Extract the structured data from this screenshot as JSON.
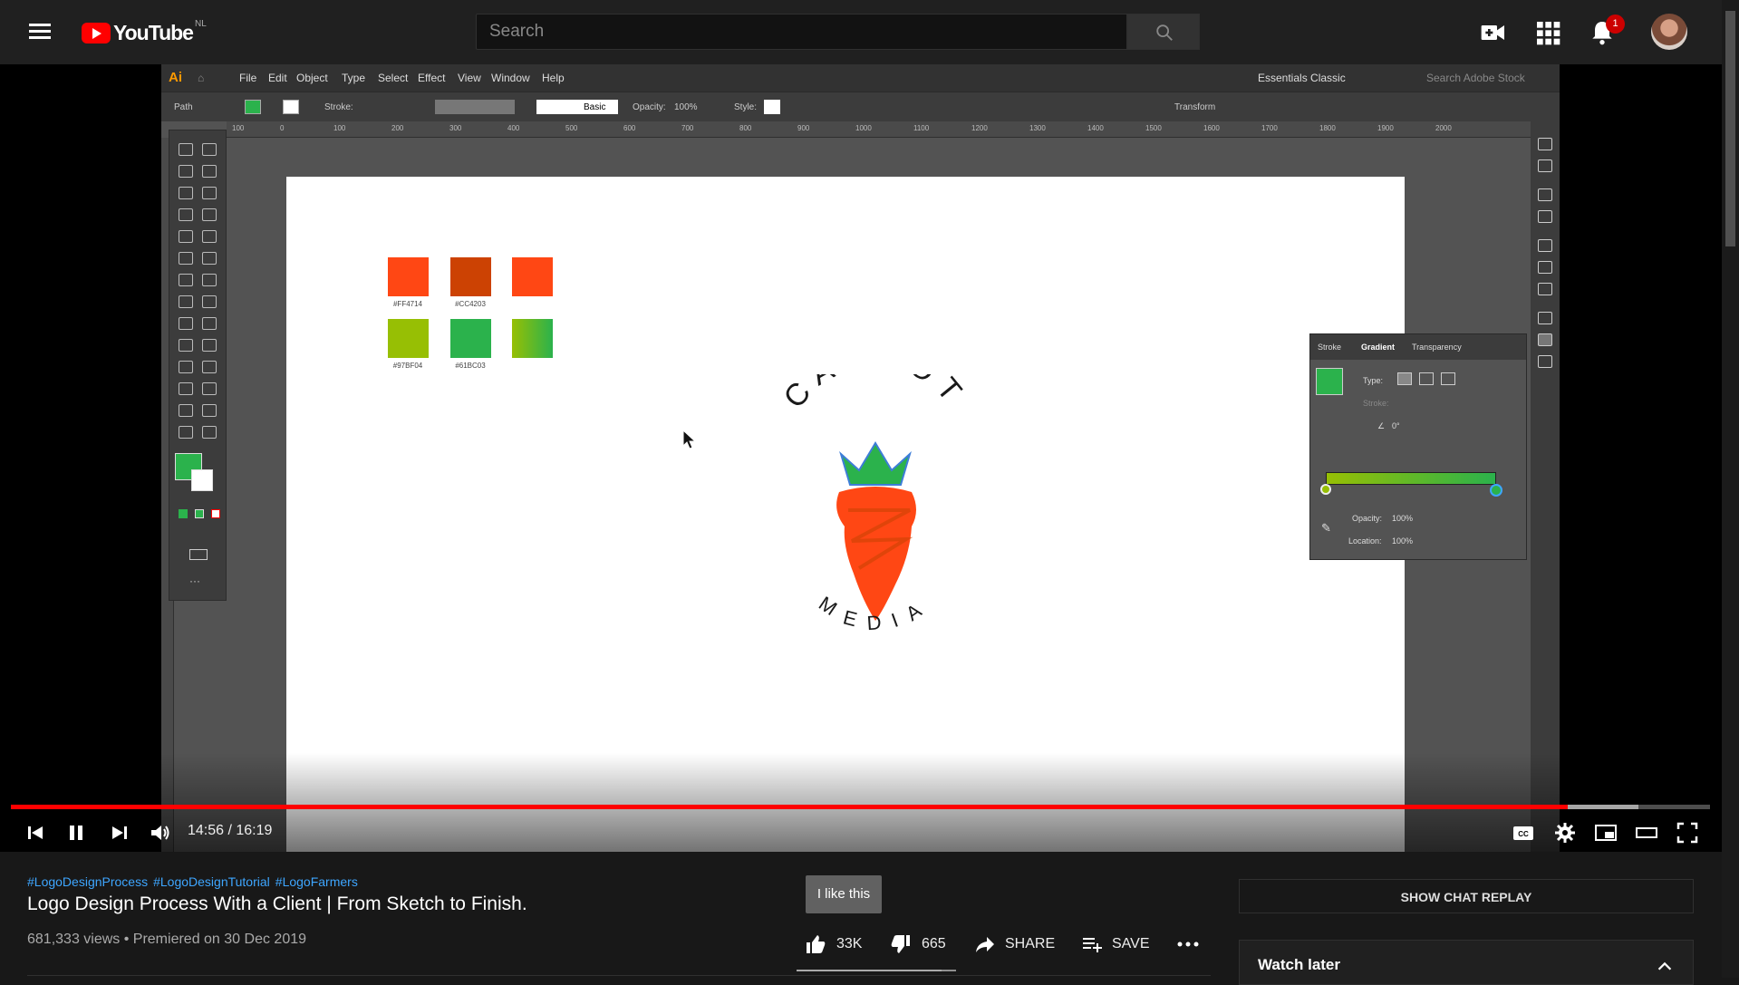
{
  "header": {
    "logo_text": "YouTube",
    "country_code": "NL",
    "search_placeholder": "Search",
    "notification_count": "1"
  },
  "illustrator": {
    "app_logo": "Ai",
    "menu": [
      "File",
      "Edit",
      "Object",
      "Type",
      "Select",
      "Effect",
      "View",
      "Window",
      "Help"
    ],
    "workspace": "Essentials Classic",
    "search_stock": "Search Adobe Stock",
    "control_bar": {
      "path": "Path",
      "stroke": "Stroke:",
      "basic": "Basic",
      "opacity_label": "Opacity:",
      "opacity_value": "100%",
      "style": "Style:",
      "transform": "Transform"
    },
    "ruler_ticks": [
      "100",
      "0",
      "100",
      "200",
      "300",
      "400",
      "500",
      "600",
      "700",
      "800",
      "900",
      "1000",
      "1100",
      "1200",
      "1300",
      "1400",
      "1500",
      "1600",
      "1700",
      "1800",
      "1900",
      "2000"
    ],
    "swatches": [
      {
        "color": "#FF4714",
        "label": "#FF4714"
      },
      {
        "color": "#CC4203",
        "label": "#CC4203"
      },
      {
        "color": "#FF4714",
        "label": ""
      },
      {
        "color": "#97BF04",
        "label": "#97BF04"
      },
      {
        "color": "#2BB24C",
        "label": "#61BC03"
      },
      {
        "color": "#4CB845",
        "label": ""
      }
    ],
    "logo": {
      "top_text": "CARROT",
      "bottom_text": "MEDIA"
    },
    "gradient_panel": {
      "tabs": [
        "Stroke",
        "Gradient",
        "Transparency"
      ],
      "type_label": "Type:",
      "stroke_label": "Stroke:",
      "angle_value": "0°",
      "opacity_label": "Opacity:",
      "opacity_value": "100%",
      "location_label": "Location:",
      "location_value": "100%"
    }
  },
  "player": {
    "current_time": "14:56",
    "duration": "16:19",
    "time_display": "14:56 / 16:19",
    "progress_fraction": 0.916,
    "buffered_fraction": 0.958
  },
  "video": {
    "hashtags": [
      "#LogoDesignProcess",
      "#LogoDesignTutorial",
      "#LogoFarmers"
    ],
    "title": "Logo Design Process With a Client | From Sketch to Finish.",
    "meta": "681,333 views • Premiered on 30 Dec 2019",
    "tooltip": "I like this",
    "likes": "33K",
    "dislikes": "665",
    "share_label": "SHARE",
    "save_label": "SAVE"
  },
  "sidebar": {
    "chat_replay": "SHOW CHAT REPLAY",
    "watch_later": "Watch later"
  },
  "colors": {
    "accent": "#FF0000",
    "link": "#3EA6FF",
    "carrot_orange": "#FF4714",
    "carrot_green": "#2BB24C"
  }
}
